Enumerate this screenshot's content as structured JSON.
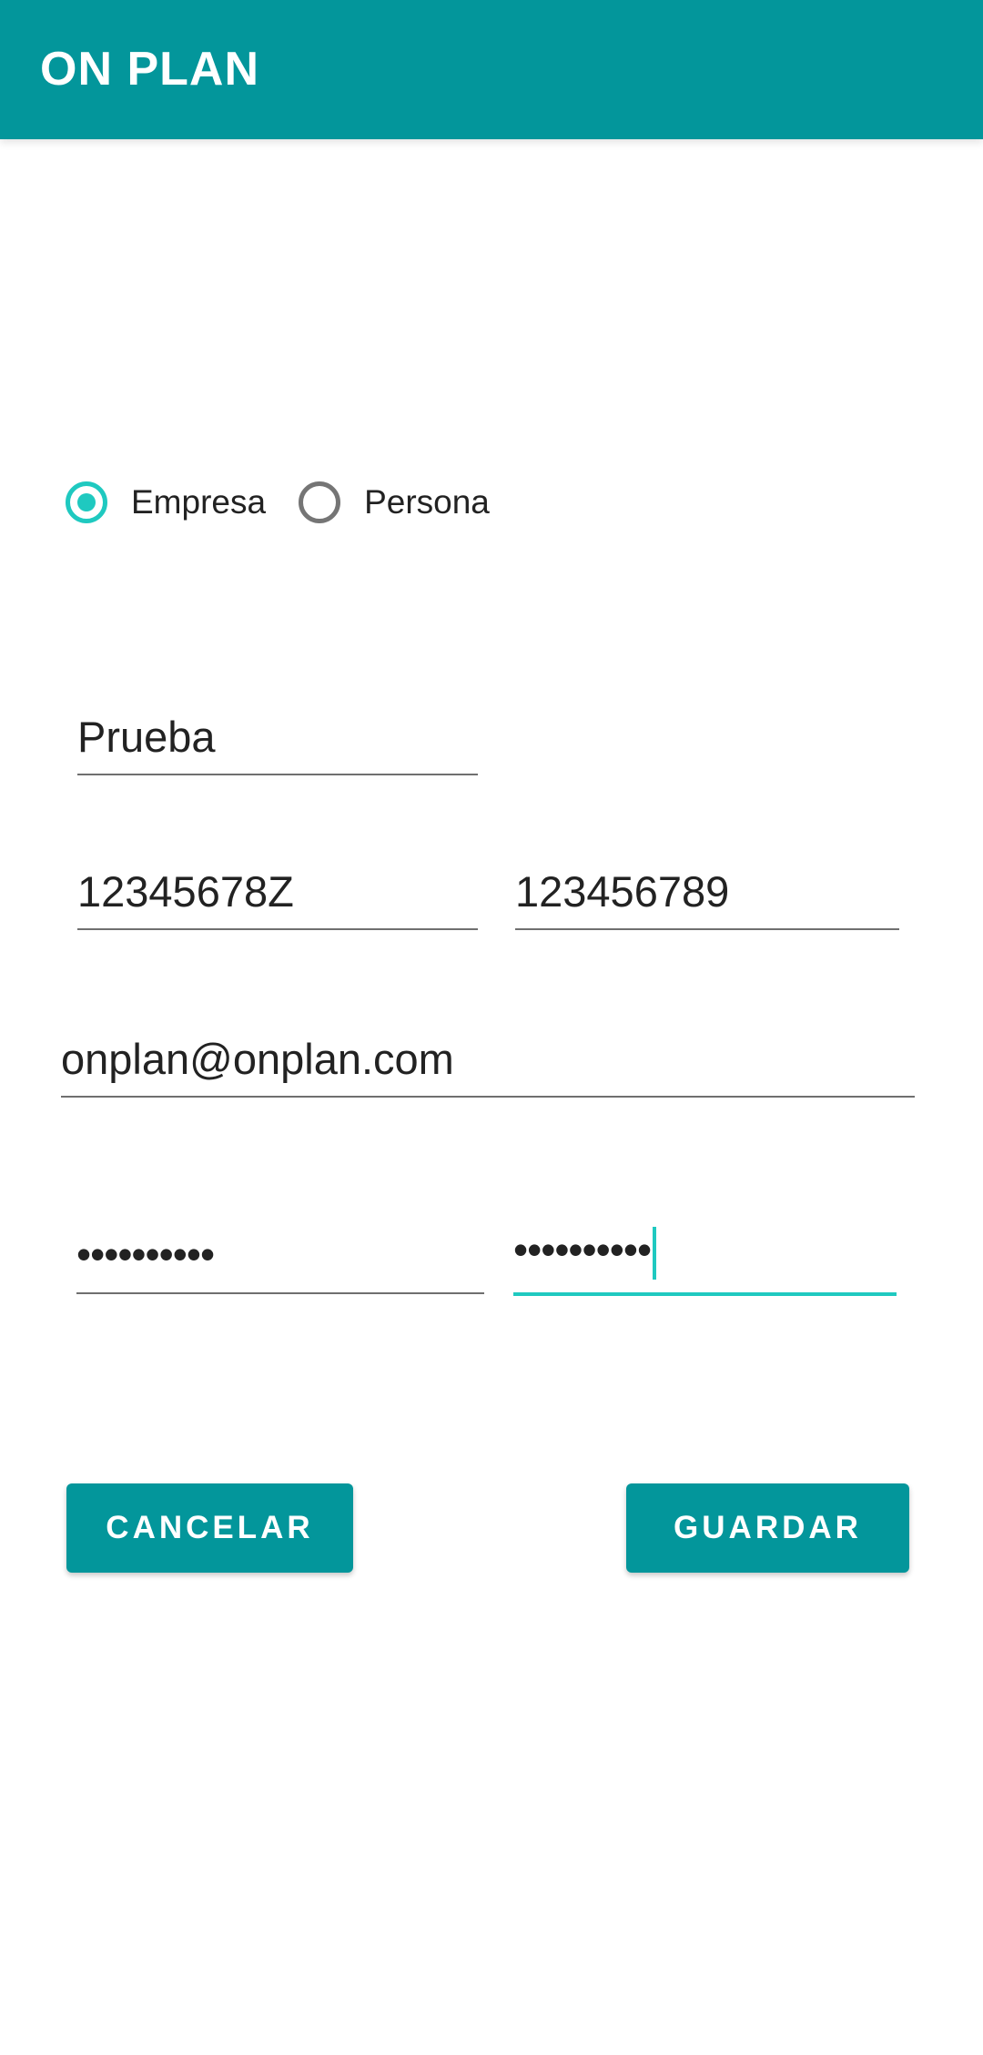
{
  "app": {
    "title": "ON PLAN"
  },
  "account_type": {
    "options": [
      {
        "label": "Empresa",
        "checked": true
      },
      {
        "label": "Persona",
        "checked": false
      }
    ]
  },
  "form": {
    "name": "Prueba",
    "tax_id": "12345678Z",
    "phone": "123456789",
    "email": "onplan@onplan.com",
    "password": "••••••••••",
    "password_confirm": "••••••••••"
  },
  "actions": {
    "cancel_label": "CANCELAR",
    "save_label": "GUARDAR"
  },
  "colors": {
    "primary": "#03969b",
    "accent": "#1fc9c0",
    "underline": "#6f6f6f"
  }
}
